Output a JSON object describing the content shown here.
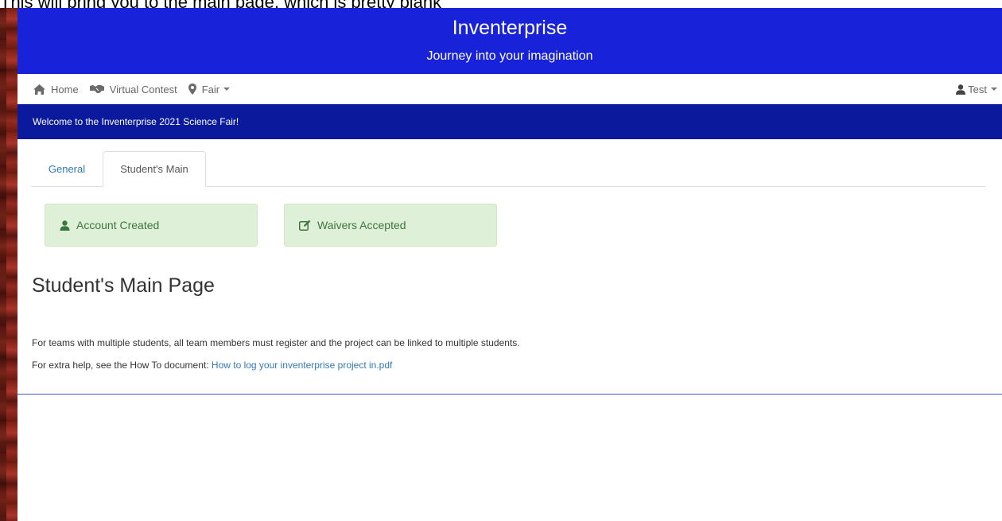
{
  "caption": "This will bring you to the main page, which is pretty blank",
  "header": {
    "title": "Inventerprise",
    "subtitle": "Journey into your imagination"
  },
  "nav": {
    "home_label": "Home",
    "virtual_contest_label": "Virtual Contest",
    "fair_label": "Fair",
    "user_label": "Test"
  },
  "welcome": {
    "message": "Welcome to the Inventerprise 2021 Science Fair!"
  },
  "tabs": {
    "general_label": "General",
    "students_main_label": "Student's Main"
  },
  "status_cards": {
    "account_label": "Account Created",
    "waivers_label": "Waivers Accepted"
  },
  "main": {
    "page_title": "Student's Main Page",
    "team_info": "For teams with multiple students, all team members must register and the project can be linked to multiple students.",
    "help_prefix": "For extra help, see the How To document:",
    "help_link": "How to log your inventerprise project in.pdf"
  },
  "colors": {
    "header_blue": "#1722d9",
    "welcome_bar_navy": "#0b1a9c",
    "link_blue": "#337ab7",
    "success_bg": "#dff0d8",
    "success_text": "#3c763d"
  },
  "icons": {
    "home": "home-icon",
    "virtual_contest": "handshake-icon",
    "fair": "map-marker-icon",
    "user": "user-icon",
    "account": "user-icon",
    "waivers": "edit-icon"
  }
}
